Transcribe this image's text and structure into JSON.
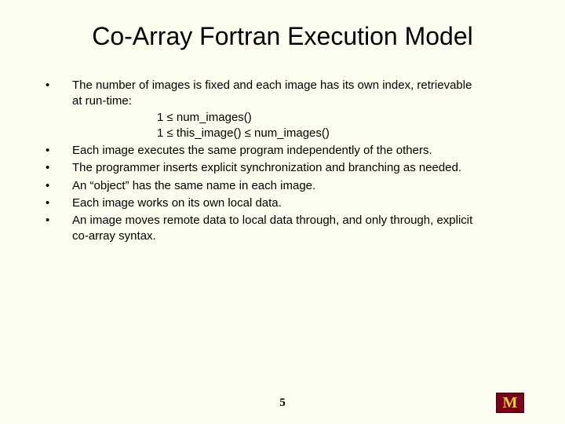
{
  "title": "Co-Array Fortran Execution Model",
  "bullets": {
    "b1_line1": "The number of images is fixed and each image has its own index, retrievable",
    "b1_line2": "at run-time:",
    "b1_sub1": "1 ≤ num_images()",
    "b1_sub2": "1 ≤ this_image()  ≤ num_images()",
    "b2": "Each image executes the same program independently of the others.",
    "b3": "The programmer inserts explicit synchronization and branching as needed.",
    "b4": "An “object” has the same name in each image.",
    "b5": "Each image works on its own local data.",
    "b6_line1": "An image moves remote data to local data through, and only through, explicit",
    "b6_line2": "co-array syntax."
  },
  "page_number": "5",
  "logo_letter": "M"
}
